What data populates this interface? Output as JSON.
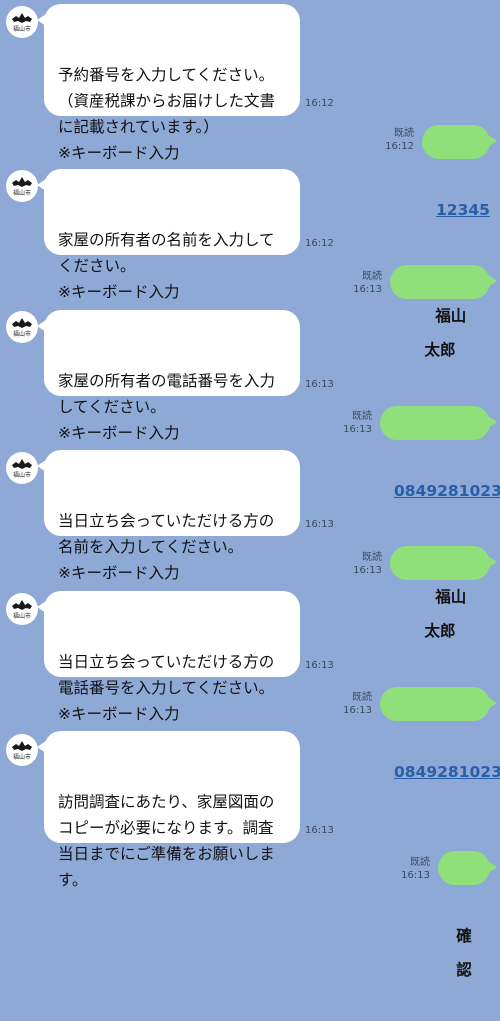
{
  "avatar": {
    "label": "福山市",
    "icon": "fukuyama-bat-logo-icon"
  },
  "messages": [
    {
      "dir": "in",
      "lines": [
        "予約番号を入力してください。",
        "（資産税課からお届けした文書",
        "に記載されています。）",
        "※キーボード入力"
      ],
      "time": "16:12"
    },
    {
      "dir": "out",
      "text": "12345",
      "read": "既読",
      "time": "16:12"
    },
    {
      "dir": "in",
      "lines": [
        "家屋の所有者の名前を入力して",
        "ください。",
        "※キーボード入力"
      ],
      "time": "16:12"
    },
    {
      "dir": "out",
      "text": "福山　太郎",
      "read": "既読",
      "time": "16:13"
    },
    {
      "dir": "in",
      "lines": [
        "家屋の所有者の電話番号を入力",
        "してください。",
        "※キーボード入力"
      ],
      "time": "16:13"
    },
    {
      "dir": "out",
      "text": "0849281023",
      "read": "既読",
      "time": "16:13"
    },
    {
      "dir": "in",
      "lines": [
        "当日立ち会っていただける方の",
        "名前を入力してください。",
        "※キーボード入力"
      ],
      "time": "16:13"
    },
    {
      "dir": "out",
      "text": "福山　太郎",
      "read": "既読",
      "time": "16:13"
    },
    {
      "dir": "in",
      "lines": [
        "当日立ち会っていただける方の",
        "電話番号を入力してください。",
        "※キーボード入力"
      ],
      "time": "16:13"
    },
    {
      "dir": "out",
      "text": "0849281023",
      "read": "既読",
      "time": "16:13"
    },
    {
      "dir": "in",
      "lines": [
        "訪問調査にあたり、家屋図面の",
        "コピーが必要になります。調査",
        "当日までにご準備をお願いしま",
        "す。"
      ],
      "time": "16:13"
    },
    {
      "dir": "out",
      "text": "確認",
      "read": "既読",
      "time": "16:13"
    }
  ]
}
